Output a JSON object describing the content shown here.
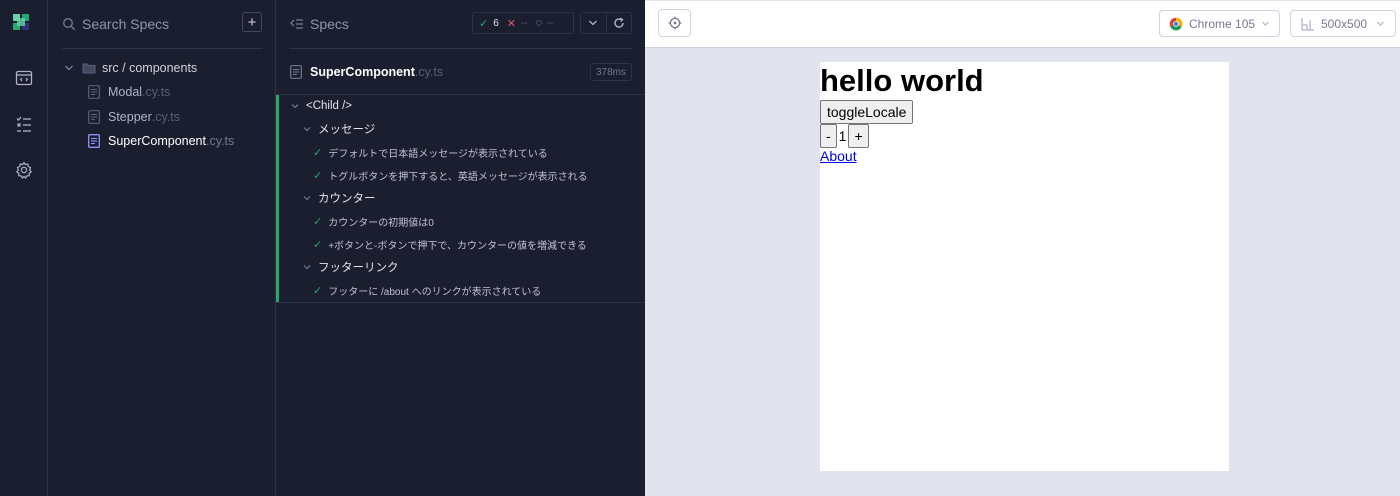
{
  "nav": {
    "items": [
      {
        "icon": "specs-icon"
      },
      {
        "icon": "runs-icon"
      },
      {
        "icon": "settings-icon"
      }
    ]
  },
  "specs_panel": {
    "search_placeholder": "Search Specs",
    "add_label": "+",
    "folder": "src / components",
    "files": [
      {
        "name": "Modal",
        "ext": ".cy.ts",
        "active": false
      },
      {
        "name": "Stepper",
        "ext": ".cy.ts",
        "active": false
      },
      {
        "name": "SuperComponent",
        "ext": ".cy.ts",
        "active": true
      }
    ]
  },
  "reporter": {
    "title": "Specs",
    "stats": {
      "passed": "6",
      "failed": "--",
      "pending": "--"
    },
    "spec_file": {
      "name": "SuperComponent",
      "ext": ".cy.ts",
      "duration": "378ms"
    },
    "root_suite": "<Child />",
    "suites": [
      {
        "title": "メッセージ",
        "tests": [
          "デフォルトで日本語メッセージが表示されている",
          "トグルボタンを押下すると、英語メッセージが表示される"
        ]
      },
      {
        "title": "カウンター",
        "tests": [
          "カウンターの初期値は0",
          "+ボタンと-ボタンで押下で、カウンターの値を増減できる"
        ]
      },
      {
        "title": "フッターリンク",
        "tests": [
          "フッターに /about へのリンクが表示されている"
        ]
      }
    ]
  },
  "aut": {
    "browser": "Chrome 105",
    "viewport": "500x500",
    "app": {
      "heading": "hello world",
      "toggle_label": "toggleLocale",
      "decrement_label": "-",
      "counter_value": "1",
      "increment_label": "+",
      "link_label": "About"
    }
  },
  "colors": {
    "sidebar_bg": "#1b1e2e",
    "pass": "#1fa971",
    "fail": "#e45770",
    "accent": "#8f95f7",
    "aut_bg": "#e1e3ed"
  }
}
